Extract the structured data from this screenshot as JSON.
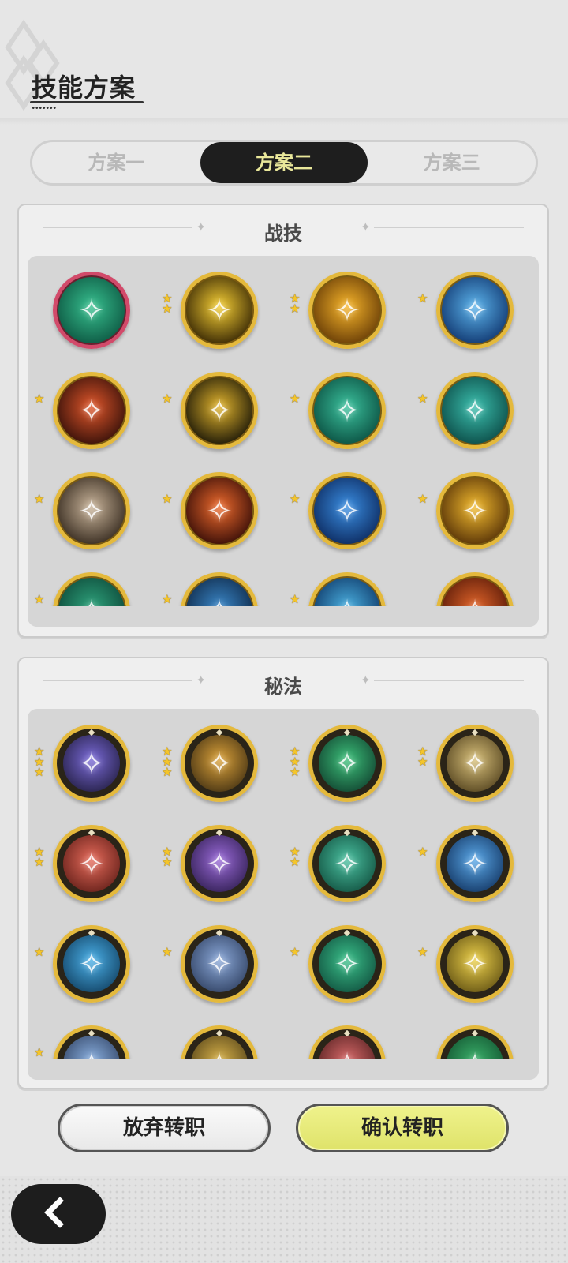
{
  "header": {
    "title": "技能方案"
  },
  "tabs": [
    {
      "label": "方案一",
      "active": false
    },
    {
      "label": "方案二",
      "active": true
    },
    {
      "label": "方案三",
      "active": false
    }
  ],
  "skills_panel": {
    "title": "战技",
    "icons": [
      {
        "name": "wind-orb-icon",
        "colors": [
          "#0e5a44",
          "#37c08f"
        ],
        "stars": 0,
        "selected": true
      },
      {
        "name": "lightning-orb-icon",
        "colors": [
          "#3b2a05",
          "#f6cf34"
        ],
        "stars": 2
      },
      {
        "name": "golden-slash-icon",
        "colors": [
          "#6b3f07",
          "#f7b52a"
        ],
        "stars": 2
      },
      {
        "name": "ice-burst-icon",
        "colors": [
          "#123a73",
          "#5cb4ec"
        ],
        "stars": 1
      },
      {
        "name": "fire-swirl-icon",
        "colors": [
          "#3a120a",
          "#e0562a"
        ],
        "stars": 1
      },
      {
        "name": "golden-crystal-icon",
        "colors": [
          "#1f1a08",
          "#e2b42c"
        ],
        "stars": 1
      },
      {
        "name": "wind-feather-icon",
        "colors": [
          "#0c5344",
          "#3bc19d"
        ],
        "stars": 1
      },
      {
        "name": "whirlwind-icon",
        "colors": [
          "#0d4f4a",
          "#3bbfae"
        ],
        "stars": 1
      },
      {
        "name": "card-summon-icon",
        "colors": [
          "#3a2e22",
          "#c9b49a"
        ],
        "stars": 1
      },
      {
        "name": "fireball-icon",
        "colors": [
          "#3b0f08",
          "#ee6a2c"
        ],
        "stars": 1
      },
      {
        "name": "water-flame-icon",
        "colors": [
          "#0e2d63",
          "#3a8ee2"
        ],
        "stars": 1
      },
      {
        "name": "light-strike-icon",
        "colors": [
          "#5a3508",
          "#f3bb2e"
        ],
        "stars": 1
      },
      {
        "name": "thorn-vine-icon",
        "colors": [
          "#0e4a3a",
          "#2ea37c"
        ],
        "stars": 1
      },
      {
        "name": "ice-spike-icon",
        "colors": [
          "#0f2a4a",
          "#3a87c8"
        ],
        "stars": 1
      },
      {
        "name": "wave-icon",
        "colors": [
          "#0f3a6a",
          "#4ab0e0"
        ],
        "stars": 1
      },
      {
        "name": "flame-wave-icon",
        "colors": [
          "#5a1a08",
          "#e2652a"
        ],
        "stars": 0
      }
    ]
  },
  "secrets_panel": {
    "title": "秘法",
    "icons": [
      {
        "name": "arcane-clock-icon",
        "colors": [
          "#1e1a3a",
          "#7a6ad8"
        ],
        "stars": 3
      },
      {
        "name": "golden-blade-icon",
        "colors": [
          "#3a2a10",
          "#dba23a"
        ],
        "stars": 3
      },
      {
        "name": "wind-gust-icon",
        "colors": [
          "#0e3a2a",
          "#3cc07a"
        ],
        "stars": 3
      },
      {
        "name": "golden-ward-icon",
        "colors": [
          "#4a3a18",
          "#d8c07a"
        ],
        "stars": 2
      },
      {
        "name": "crimson-flame-icon",
        "colors": [
          "#5a1a14",
          "#e66a5a"
        ],
        "stars": 2
      },
      {
        "name": "shadow-swirl-icon",
        "colors": [
          "#2a1a4a",
          "#9a6ad8"
        ],
        "stars": 2
      },
      {
        "name": "emerald-shield-icon",
        "colors": [
          "#0e4a3a",
          "#4ac0a0"
        ],
        "stars": 2
      },
      {
        "name": "frost-shard-icon",
        "colors": [
          "#0e2e5a",
          "#5aa8e8"
        ],
        "stars": 1
      },
      {
        "name": "water-drop-icon",
        "colors": [
          "#0e3a5a",
          "#4ab0e8"
        ],
        "stars": 1
      },
      {
        "name": "steel-armor-icon",
        "colors": [
          "#2a3a5a",
          "#8aa8d8"
        ],
        "stars": 1
      },
      {
        "name": "nature-spirit-icon",
        "colors": [
          "#0e4a3a",
          "#3ac08a"
        ],
        "stars": 1
      },
      {
        "name": "holy-spirit-icon",
        "colors": [
          "#5a4a10",
          "#ecd04a"
        ],
        "stars": 1
      },
      {
        "name": "sky-rise-icon",
        "colors": [
          "#2a3a5a",
          "#8ab0e0"
        ],
        "stars": 1
      },
      {
        "name": "golden-arrow-icon",
        "colors": [
          "#4a3a14",
          "#d8b24a"
        ],
        "stars": 0
      },
      {
        "name": "blood-rune-icon",
        "colors": [
          "#4a1a1a",
          "#d86a6a"
        ],
        "stars": 0
      },
      {
        "name": "verdant-heart-icon",
        "colors": [
          "#0e4a2a",
          "#3ab06a"
        ],
        "stars": 0
      }
    ]
  },
  "actions": {
    "abandon_label": "放弃转职",
    "confirm_label": "确认转职"
  },
  "nav": {
    "back_icon": "chevron-left-icon"
  }
}
